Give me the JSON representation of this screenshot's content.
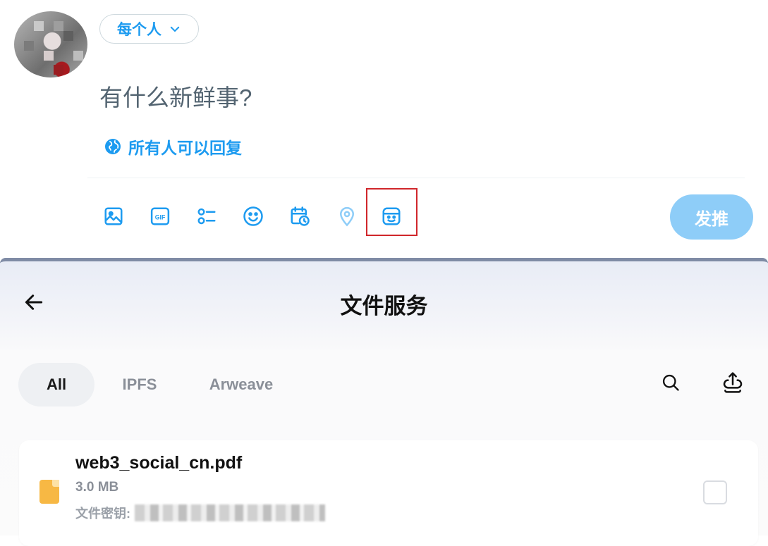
{
  "composer": {
    "audience_label": "每个人",
    "prompt_placeholder": "有什么新鲜事?",
    "reply_setting": "所有人可以回复",
    "post_button": "发推",
    "toolbar": [
      {
        "icon": "image-icon"
      },
      {
        "icon": "gif-icon"
      },
      {
        "icon": "poll-icon"
      },
      {
        "icon": "emoji-icon"
      },
      {
        "icon": "schedule-icon"
      },
      {
        "icon": "location-icon"
      },
      {
        "icon": "file-service-icon"
      }
    ],
    "gif_text": "GIF",
    "accent_color": "#1d9bf0"
  },
  "file_service": {
    "title": "文件服务",
    "tabs": [
      {
        "label": "All",
        "active": true
      },
      {
        "label": "IPFS",
        "active": false
      },
      {
        "label": "Arweave",
        "active": false
      }
    ],
    "files": [
      {
        "name": "web3_social_cn.pdf",
        "size": "3.0 MB",
        "key_label": "文件密钥:",
        "checked": false
      }
    ]
  }
}
